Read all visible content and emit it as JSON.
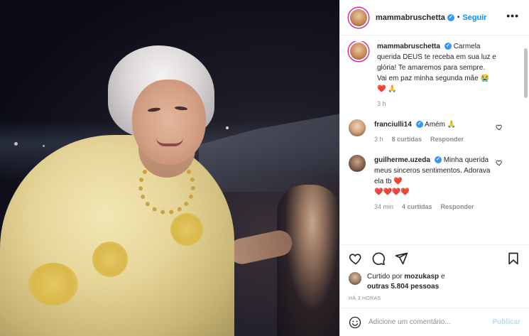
{
  "header": {
    "username": "mammabruschetta",
    "follow_label": "Seguir",
    "separator": "•",
    "more_glyph": "•••"
  },
  "caption": {
    "username": "mammabruschetta",
    "text": "Carmela querida DEUS te receba em sua luz e glória! Te amaremos para sempre. Vai em paz minha segunda mãe",
    "emoji": "😭❤️ 🙏",
    "time": "3 h"
  },
  "comments": [
    {
      "username": "franciulli14",
      "text": "Amém",
      "emoji": "🙏",
      "time": "3 h",
      "likes": "8 curtidas",
      "reply": "Responder"
    },
    {
      "username": "guilherme.uzeda",
      "text": "Minha querida meus sinceros sentimentos. Adorava ela tb",
      "emoji": "❤️",
      "emoji_line": "❤️❤️❤️❤️",
      "time": "34 min",
      "likes": "4 curtidas",
      "reply": "Responder"
    }
  ],
  "likes": {
    "prefix": "Curtido por",
    "user": "mozukasp",
    "middle": "e",
    "others": "outras 5.804 pessoas"
  },
  "timestamp": "HÁ 3 HORAS",
  "add_comment": {
    "placeholder": "Adicione um comentário...",
    "publish_label": "Publicar"
  },
  "icons": [
    "heart-icon",
    "comment-icon",
    "share-icon",
    "bookmark-icon",
    "emoji-icon",
    "more-icon",
    "verified-icon"
  ],
  "colors": {
    "accent": "#0095f6",
    "verified": "#3897f0",
    "publish_disabled": "#b2dffc",
    "heart": "#e0245e"
  }
}
